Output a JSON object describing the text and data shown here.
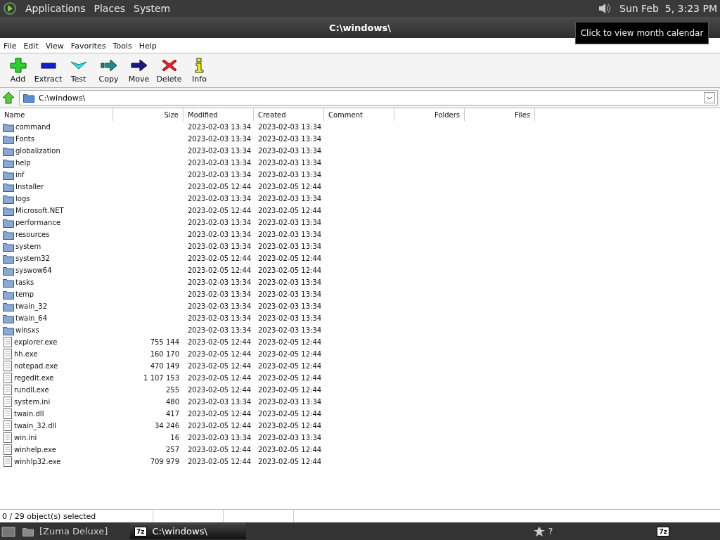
{
  "top_panel": {
    "menus": [
      "Applications",
      "Places",
      "System"
    ],
    "clock": "Sun Feb  5, 3:23 PM",
    "tooltip": "Click to view month calendar"
  },
  "window": {
    "title": "C:\\windows\\"
  },
  "menu_bar": [
    "File",
    "Edit",
    "View",
    "Favorites",
    "Tools",
    "Help"
  ],
  "toolbar": [
    {
      "label": "Add",
      "kind": "add"
    },
    {
      "label": "Extract",
      "kind": "extract"
    },
    {
      "label": "Test",
      "kind": "test"
    },
    {
      "label": "Copy",
      "kind": "copy"
    },
    {
      "label": "Move",
      "kind": "move"
    },
    {
      "label": "Delete",
      "kind": "delete"
    },
    {
      "label": "Info",
      "kind": "info"
    }
  ],
  "address": {
    "value": "C:\\windows\\"
  },
  "table": {
    "columns": [
      "Name",
      "Size",
      "Modified",
      "Created",
      "Comment",
      "Folders",
      "Files"
    ],
    "rows": [
      {
        "kind": "folder",
        "name": "command",
        "size": "",
        "modified": "2023-02-03 13:34",
        "created": "2023-02-03 13:34"
      },
      {
        "kind": "folder",
        "name": "Fonts",
        "size": "",
        "modified": "2023-02-03 13:34",
        "created": "2023-02-03 13:34"
      },
      {
        "kind": "folder",
        "name": "globalization",
        "size": "",
        "modified": "2023-02-03 13:34",
        "created": "2023-02-03 13:34"
      },
      {
        "kind": "folder",
        "name": "help",
        "size": "",
        "modified": "2023-02-03 13:34",
        "created": "2023-02-03 13:34"
      },
      {
        "kind": "folder",
        "name": "inf",
        "size": "",
        "modified": "2023-02-03 13:34",
        "created": "2023-02-03 13:34"
      },
      {
        "kind": "folder",
        "name": "Installer",
        "size": "",
        "modified": "2023-02-05 12:44",
        "created": "2023-02-05 12:44"
      },
      {
        "kind": "folder",
        "name": "logs",
        "size": "",
        "modified": "2023-02-03 13:34",
        "created": "2023-02-03 13:34"
      },
      {
        "kind": "folder",
        "name": "Microsoft.NET",
        "size": "",
        "modified": "2023-02-05 12:44",
        "created": "2023-02-05 12:44"
      },
      {
        "kind": "folder",
        "name": "performance",
        "size": "",
        "modified": "2023-02-03 13:34",
        "created": "2023-02-03 13:34"
      },
      {
        "kind": "folder",
        "name": "resources",
        "size": "",
        "modified": "2023-02-03 13:34",
        "created": "2023-02-03 13:34"
      },
      {
        "kind": "folder",
        "name": "system",
        "size": "",
        "modified": "2023-02-03 13:34",
        "created": "2023-02-03 13:34"
      },
      {
        "kind": "folder",
        "name": "system32",
        "size": "",
        "modified": "2023-02-05 12:44",
        "created": "2023-02-05 12:44"
      },
      {
        "kind": "folder",
        "name": "syswow64",
        "size": "",
        "modified": "2023-02-05 12:44",
        "created": "2023-02-05 12:44"
      },
      {
        "kind": "folder",
        "name": "tasks",
        "size": "",
        "modified": "2023-02-03 13:34",
        "created": "2023-02-03 13:34"
      },
      {
        "kind": "folder",
        "name": "temp",
        "size": "",
        "modified": "2023-02-03 13:34",
        "created": "2023-02-03 13:34"
      },
      {
        "kind": "folder",
        "name": "twain_32",
        "size": "",
        "modified": "2023-02-03 13:34",
        "created": "2023-02-03 13:34"
      },
      {
        "kind": "folder",
        "name": "twain_64",
        "size": "",
        "modified": "2023-02-03 13:34",
        "created": "2023-02-03 13:34"
      },
      {
        "kind": "folder",
        "name": "winsxs",
        "size": "",
        "modified": "2023-02-03 13:34",
        "created": "2023-02-03 13:34"
      },
      {
        "kind": "file",
        "name": "explorer.exe",
        "size": "755 144",
        "modified": "2023-02-05 12:44",
        "created": "2023-02-05 12:44"
      },
      {
        "kind": "file",
        "name": "hh.exe",
        "size": "160 170",
        "modified": "2023-02-05 12:44",
        "created": "2023-02-05 12:44"
      },
      {
        "kind": "file",
        "name": "notepad.exe",
        "size": "470 149",
        "modified": "2023-02-05 12:44",
        "created": "2023-02-05 12:44"
      },
      {
        "kind": "file",
        "name": "regedit.exe",
        "size": "1 107 153",
        "modified": "2023-02-05 12:44",
        "created": "2023-02-05 12:44"
      },
      {
        "kind": "file",
        "name": "rundll.exe",
        "size": "255",
        "modified": "2023-02-05 12:44",
        "created": "2023-02-05 12:44"
      },
      {
        "kind": "file",
        "name": "system.ini",
        "size": "480",
        "modified": "2023-02-03 13:34",
        "created": "2023-02-03 13:34"
      },
      {
        "kind": "file",
        "name": "twain.dll",
        "size": "417",
        "modified": "2023-02-05 12:44",
        "created": "2023-02-05 12:44"
      },
      {
        "kind": "file",
        "name": "twain_32.dll",
        "size": "34 246",
        "modified": "2023-02-05 12:44",
        "created": "2023-02-05 12:44"
      },
      {
        "kind": "file",
        "name": "win.ini",
        "size": "16",
        "modified": "2023-02-03 13:34",
        "created": "2023-02-03 13:34"
      },
      {
        "kind": "file",
        "name": "winhelp.exe",
        "size": "257",
        "modified": "2023-02-05 12:44",
        "created": "2023-02-05 12:44"
      },
      {
        "kind": "file",
        "name": "winhlp32.exe",
        "size": "709 979",
        "modified": "2023-02-05 12:44",
        "created": "2023-02-05 12:44"
      }
    ]
  },
  "status_bar": "0 / 29 object(s) selected",
  "taskbar": {
    "tasks": [
      {
        "label": "[Zuma Deluxe]",
        "selected": false
      },
      {
        "label": "C:\\windows\\",
        "selected": true,
        "icon_text": "7z"
      }
    ],
    "tray_text": "?",
    "tray_icon_text": "7z"
  }
}
